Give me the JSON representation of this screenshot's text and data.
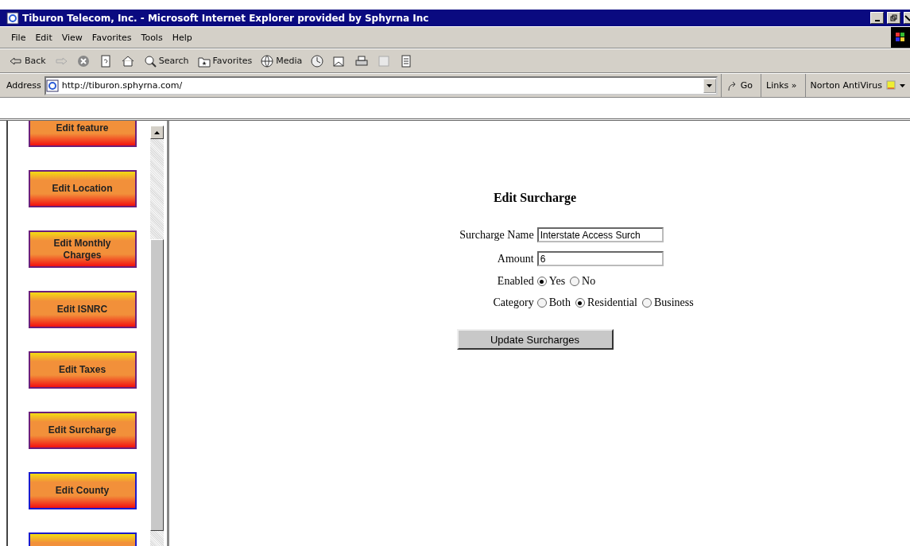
{
  "window": {
    "title": "Tiburon Telecom, Inc. - Microsoft Internet Explorer provided by Sphyrna Inc"
  },
  "menu": [
    "File",
    "Edit",
    "View",
    "Favorites",
    "Tools",
    "Help"
  ],
  "toolbar": [
    {
      "kind": "back",
      "label": "Back"
    },
    {
      "kind": "forward"
    },
    {
      "kind": "stop"
    },
    {
      "kind": "refresh"
    },
    {
      "kind": "home"
    },
    {
      "kind": "search",
      "label": "Search"
    },
    {
      "kind": "favorites",
      "label": "Favorites"
    },
    {
      "kind": "media",
      "label": "Media"
    },
    {
      "kind": "history"
    },
    {
      "kind": "mail"
    },
    {
      "kind": "print"
    },
    {
      "kind": "edit"
    },
    {
      "kind": "discuss"
    }
  ],
  "address": {
    "label": "Address",
    "url": "http://tiburon.sphyrna.com/",
    "go": "Go",
    "links": "Links",
    "links_more": "»",
    "norton": "Norton AntiVirus"
  },
  "sidebar": {
    "items": [
      {
        "label": "Edit feature",
        "color": "#6b1f7a"
      },
      {
        "label": "Edit Location",
        "color": "#6b1f7a"
      },
      {
        "label": "Edit Monthly Charges",
        "color": "#6b1f7a"
      },
      {
        "label": "Edit ISNRC",
        "color": "#6b1f7a"
      },
      {
        "label": "Edit Taxes",
        "color": "#6b1f7a"
      },
      {
        "label": "Edit Surcharge",
        "color": "#6b1f7a"
      },
      {
        "label": "Edit County",
        "color": "#1a1acc"
      },
      {
        "color": "#1a1acc"
      }
    ]
  },
  "form": {
    "title": "Edit Surcharge",
    "fields": [
      {
        "label": "Surcharge Name",
        "value": "Interstate Access Surch"
      },
      {
        "label": "Amount",
        "value": "6"
      }
    ],
    "radios": [
      {
        "label": "Enabled",
        "options": [
          {
            "label": "Yes",
            "selected": true
          },
          {
            "label": "No",
            "selected": false
          }
        ]
      },
      {
        "label": "Category",
        "options": [
          {
            "label": "Both",
            "selected": false
          },
          {
            "label": "Residential",
            "selected": true
          },
          {
            "label": "Business",
            "selected": false
          }
        ]
      }
    ],
    "submit": "Update Surcharges"
  }
}
